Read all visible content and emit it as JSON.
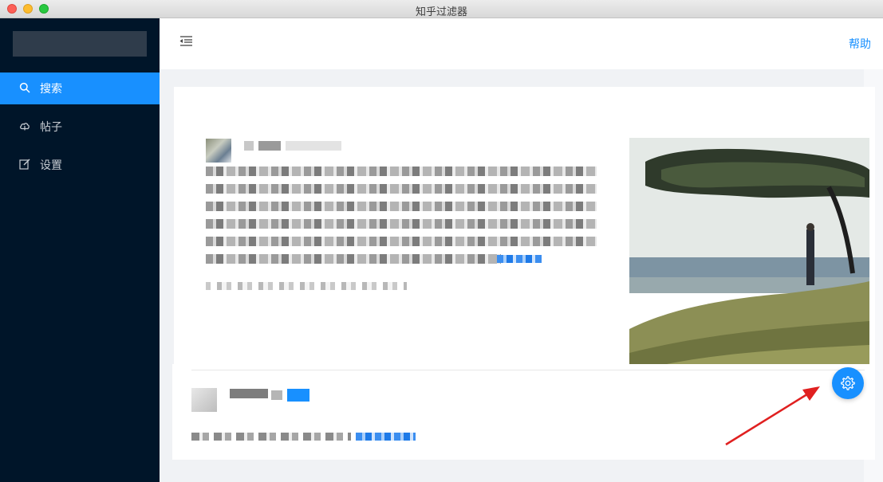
{
  "window": {
    "title": "知乎过滤器"
  },
  "sidebar": {
    "items": [
      {
        "label": "搜索",
        "icon": "search-icon",
        "active": true
      },
      {
        "label": "帖子",
        "icon": "cloud-icon",
        "active": false
      },
      {
        "label": "设置",
        "icon": "edit-icon",
        "active": false
      }
    ]
  },
  "header": {
    "help_label": "帮助",
    "menu_icon": "menu-fold-icon"
  },
  "floating_button": {
    "icon": "gear-icon"
  },
  "colors": {
    "sidebar_bg": "#001529",
    "accent": "#1890ff",
    "content_bg": "#f0f2f5",
    "annotation_arrow": "#e02020"
  }
}
